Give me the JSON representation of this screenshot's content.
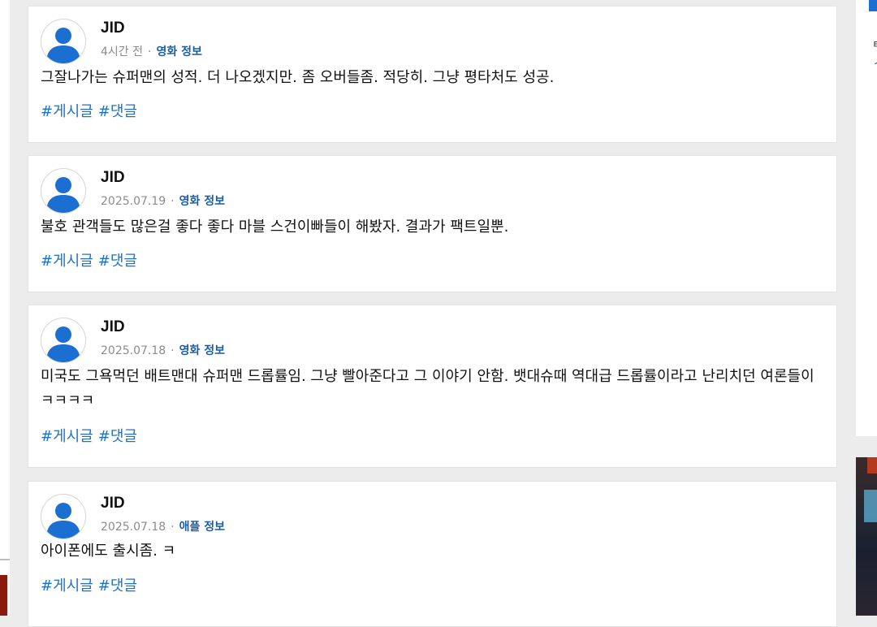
{
  "posts": [
    {
      "author": "JID",
      "time": "4시간 전",
      "category": "영화 정보",
      "text": "그잘나가는 슈퍼맨의 성적. 더 나오겠지만. 좀 오버들좀. 적당히. 그냥 평타처도 성공.",
      "tags": [
        "#게시글",
        "#댓글"
      ]
    },
    {
      "author": "JID",
      "time": "2025.07.19",
      "category": "영화 정보",
      "text": "불호 관객들도 많은걸 좋다 좋다 마블 스건이빠들이 해봤자. 결과가 팩트일뿐.",
      "tags": [
        "#게시글",
        "#댓글"
      ]
    },
    {
      "author": "JID",
      "time": "2025.07.18",
      "category": "영화 정보",
      "text": "미국도 그욕먹던 배트맨대 슈퍼맨 드롭률임. 그냥 빨아준다고 그 이야기 안함. 뱃대슈때 역대급 드롭률이라고 난리치던 여론들이 ㅋㅋㅋㅋ",
      "tags": [
        "#게시글",
        "#댓글"
      ]
    },
    {
      "author": "JID",
      "time": "2025.07.18",
      "category": "애플 정보",
      "text": "아이폰에도 출시좀. ㅋ",
      "tags": [
        "#게시글",
        "#댓글"
      ]
    }
  ],
  "sidebar": {
    "glyph_top": "ㅌ",
    "glyph_link": "ㅅ"
  },
  "colors": {
    "avatar_blue": "#1b6fd0",
    "category_blue": "#1a5da6",
    "tag_blue": "#1f73c7"
  }
}
